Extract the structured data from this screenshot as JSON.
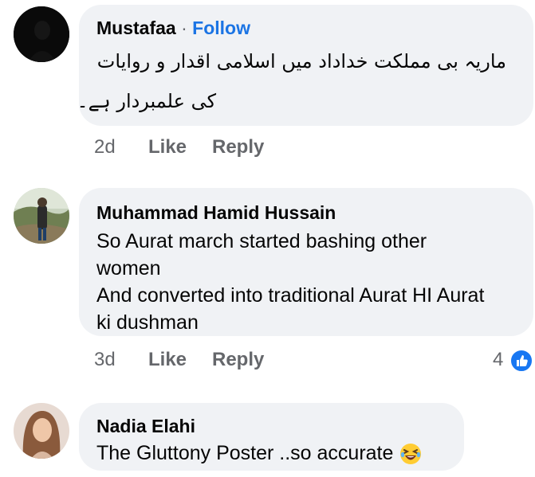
{
  "comments": [
    {
      "author": "Mustafaa",
      "separator": "·",
      "follow_label": "Follow",
      "lines": [
        "ماریہ بی مملکت خداداد میں اسلامی اقدار و روایات",
        "کی علمبردار ہے۔"
      ],
      "time": "2d",
      "like_label": "Like",
      "reply_label": "Reply"
    },
    {
      "author": "Muhammad Hamid Hussain",
      "lines": [
        "So Aurat march started bashing other",
        "women",
        "And converted into traditional Aurat HI Aurat",
        "ki dushman"
      ],
      "time": "3d",
      "like_label": "Like",
      "reply_label": "Reply",
      "reaction_count": "4",
      "reaction_icon": "like-icon"
    },
    {
      "author": "Nadia Elahi",
      "lines": [
        "The Gluttony Poster ..so accurate"
      ],
      "emoji": "laughing-emoji-icon"
    }
  ],
  "colors": {
    "bubble": "#f0f2f5",
    "follow": "#1b74e4",
    "meta": "#65676b",
    "like_badge": "#1877f2"
  }
}
